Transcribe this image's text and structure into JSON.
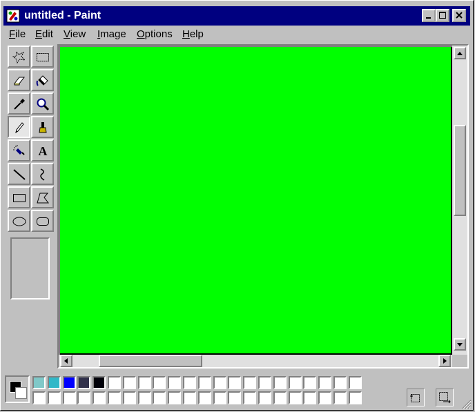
{
  "window": {
    "title": "untitled - Paint",
    "colors": {
      "titlebar": "#000080",
      "face": "#c0c0c0"
    }
  },
  "menu": [
    {
      "label": "File",
      "accel": "F",
      "rest": "ile"
    },
    {
      "label": "Edit",
      "accel": "E",
      "rest": "dit"
    },
    {
      "label": "View",
      "accel": "V",
      "rest": "iew"
    },
    {
      "label": "Image",
      "accel": "I",
      "rest": "mage"
    },
    {
      "label": "Options",
      "accel": "O",
      "rest": "ptions"
    },
    {
      "label": "Help",
      "accel": "H",
      "rest": "elp"
    }
  ],
  "tools": [
    {
      "name": "free-form-select",
      "icon": "free-select-icon",
      "active": false
    },
    {
      "name": "select",
      "icon": "rect-select-icon",
      "active": false
    },
    {
      "name": "eraser",
      "icon": "eraser-icon",
      "active": false
    },
    {
      "name": "fill-with-color",
      "icon": "fill-bucket-icon",
      "active": false
    },
    {
      "name": "pick-color",
      "icon": "eyedropper-icon",
      "active": false
    },
    {
      "name": "magnifier",
      "icon": "magnifier-icon",
      "active": false
    },
    {
      "name": "pencil",
      "icon": "pencil-icon",
      "active": true
    },
    {
      "name": "brush",
      "icon": "brush-icon",
      "active": false
    },
    {
      "name": "airbrush",
      "icon": "airbrush-icon",
      "active": false
    },
    {
      "name": "text",
      "icon": "text-icon",
      "active": false,
      "glyph": "A"
    },
    {
      "name": "line",
      "icon": "line-icon",
      "active": false
    },
    {
      "name": "curve",
      "icon": "curve-icon",
      "active": false
    },
    {
      "name": "rectangle",
      "icon": "rectangle-icon",
      "active": false
    },
    {
      "name": "polygon",
      "icon": "polygon-icon",
      "active": false
    },
    {
      "name": "ellipse",
      "icon": "ellipse-icon",
      "active": false
    },
    {
      "name": "rounded-rectangle",
      "icon": "rounded-rect-icon",
      "active": false
    }
  ],
  "canvas": {
    "color": "#00ff00"
  },
  "scrollbars": {
    "vertical": {
      "position": 0.35
    },
    "horizontal": {
      "position": 0.0
    }
  },
  "palette": {
    "foreground": "#000000",
    "background": "#ffffff",
    "top_row": [
      "#80c8c8",
      "#30b8c8",
      "#0000ff",
      "#30304a",
      "#000008",
      "#ffffff",
      "#ffffff",
      "#ffffff",
      "#ffffff",
      "#ffffff",
      "#ffffff",
      "#ffffff",
      "#ffffff",
      "#ffffff",
      "#ffffff",
      "#ffffff",
      "#ffffff",
      "#ffffff",
      "#ffffff",
      "#ffffff",
      "#ffffff",
      "#ffffff"
    ],
    "bottom_row": [
      "#ffffff",
      "#ffffff",
      "#ffffff",
      "#ffffff",
      "#ffffff",
      "#ffffff",
      "#ffffff",
      "#ffffff",
      "#ffffff",
      "#ffffff",
      "#ffffff",
      "#ffffff",
      "#ffffff",
      "#ffffff",
      "#ffffff",
      "#ffffff",
      "#ffffff",
      "#ffffff",
      "#ffffff",
      "#ffffff",
      "#ffffff",
      "#ffffff"
    ]
  },
  "status": {
    "icons": [
      "selection-position-icon",
      "selection-size-icon"
    ]
  }
}
